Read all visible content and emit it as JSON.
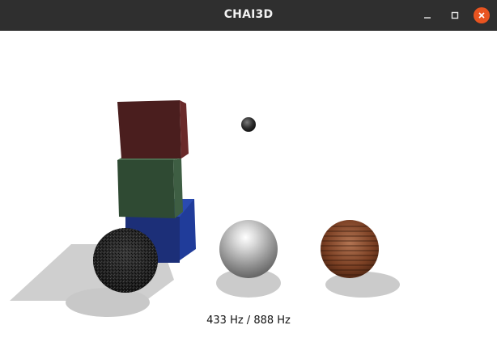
{
  "window": {
    "title": "CHAI3D",
    "accent_close": "#e95420",
    "titlebar_color": "#2f2f2f"
  },
  "titlebar_buttons": {
    "minimize_icon": "minimize-icon",
    "maximize_icon": "maximize-icon",
    "close_icon": "close-icon"
  },
  "scene": {
    "objects": [
      "red-cube",
      "green-cube",
      "blue-cube",
      "black-textured-sphere",
      "silver-sphere",
      "wooden-sphere",
      "small-dark-sphere"
    ],
    "colors": {
      "red_cube": "#4a1e1e",
      "green_cube": "#2f4a33",
      "blue_cube": "#1c2f78",
      "shadow": "#cfcfcf"
    }
  },
  "status": {
    "rate_text": "433 Hz / 888 Hz"
  }
}
